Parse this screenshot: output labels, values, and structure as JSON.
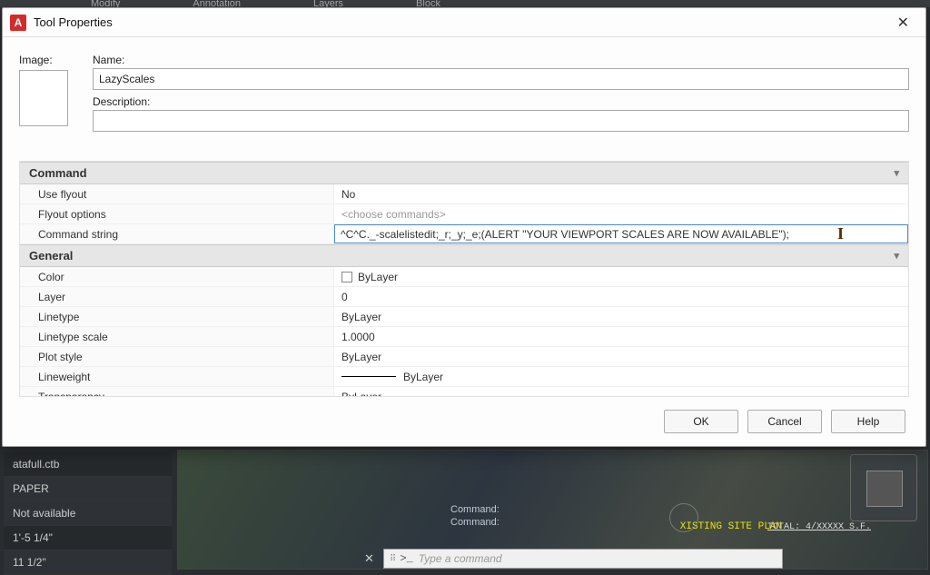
{
  "ribbon": {
    "tabs": [
      "Modify",
      "Annotation",
      "Layers",
      "Block"
    ]
  },
  "dialog": {
    "title": "Tool Properties",
    "image_label": "Image:",
    "name_label": "Name:",
    "name_value": "LazyScales",
    "desc_label": "Description:",
    "desc_value": "",
    "buttons": {
      "ok": "OK",
      "cancel": "Cancel",
      "help": "Help"
    }
  },
  "sections": {
    "command": {
      "header": "Command",
      "rows": {
        "use_flyout": {
          "label": "Use flyout",
          "value": "No"
        },
        "flyout_options": {
          "label": "Flyout options",
          "value": "<choose commands>"
        },
        "command_string": {
          "label": "Command string",
          "value": "^C^C._-scalelistedit;_r;_y;_e;(ALERT \"YOUR VIEWPORT SCALES ARE NOW AVAILABLE\");"
        }
      }
    },
    "general": {
      "header": "General",
      "rows": {
        "color": {
          "label": "Color",
          "value": "ByLayer"
        },
        "layer": {
          "label": "Layer",
          "value": "0"
        },
        "linetype": {
          "label": "Linetype",
          "value": "ByLayer"
        },
        "linetype_scale": {
          "label": "Linetype scale",
          "value": "1.0000"
        },
        "plot_style": {
          "label": "Plot style",
          "value": "ByLayer"
        },
        "lineweight": {
          "label": "Lineweight",
          "value": "ByLayer"
        },
        "transparency": {
          "label": "Transparency",
          "value": "ByLayer"
        }
      }
    }
  },
  "background": {
    "left_rows": [
      "atafull.ctb",
      "PAPER",
      "Not available",
      "1'-5 1/4\"",
      "11 1/2\""
    ],
    "cmd_lines": [
      "Command:",
      "Command:"
    ],
    "site_text": "XISTING SITE PLAN",
    "total_text": "TOTAL: 4/XXXXX S.F.",
    "cmd_bar_prompt": ">_",
    "cmd_bar_placeholder": "Type a command"
  }
}
